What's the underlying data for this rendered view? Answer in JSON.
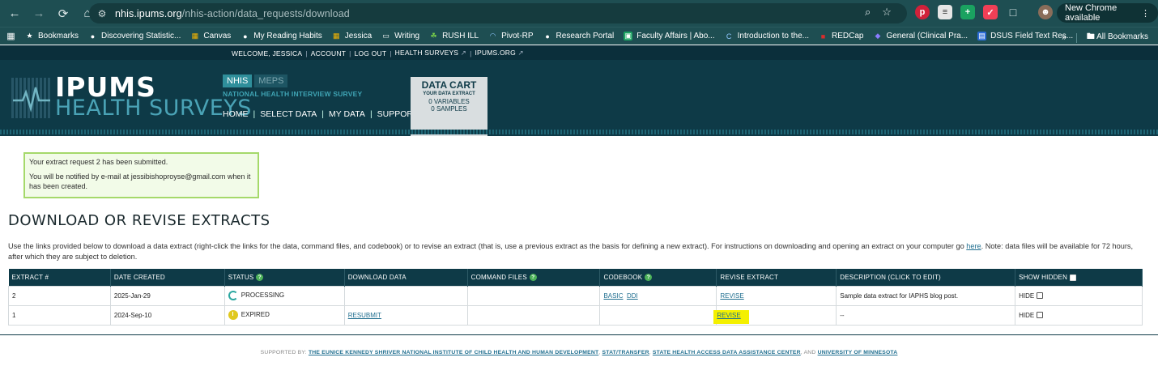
{
  "browser": {
    "url_host": "nhis.ipums.org",
    "url_path": "/nhis-action/data_requests/download",
    "new_chrome_label": "New Chrome available"
  },
  "bookmarks": {
    "items": [
      {
        "label": "Bookmarks",
        "icon": "star-icon"
      },
      {
        "label": "Discovering Statistic...",
        "icon": "globe-icon"
      },
      {
        "label": "Canvas",
        "icon": "grid-icon"
      },
      {
        "label": "My Reading Habits",
        "icon": "globe-icon"
      },
      {
        "label": "Jessica",
        "icon": "grid-icon"
      },
      {
        "label": "Writing",
        "icon": "folder-icon"
      },
      {
        "label": "RUSH ILL",
        "icon": "leaf-icon"
      },
      {
        "label": "Pivot-RP",
        "icon": "arc-icon"
      },
      {
        "label": "Research Portal",
        "icon": "globe-icon"
      },
      {
        "label": "Faculty Affairs | Abo...",
        "icon": "square-icon"
      },
      {
        "label": "Introduction to the...",
        "icon": "c-icon"
      },
      {
        "label": "REDCap",
        "icon": "redcap-icon"
      },
      {
        "label": "General (Clinical Pra...",
        "icon": "teams-icon"
      },
      {
        "label": "DSUS Field Text Res...",
        "icon": "doc-icon"
      }
    ],
    "all_bookmarks": "All Bookmarks"
  },
  "header": {
    "welcome": "WELCOME, JESSICA",
    "account": "ACCOUNT",
    "logout": "LOG OUT",
    "health_surveys": "HEALTH SURVEYS",
    "ipums_org": "IPUMS.ORG",
    "logo_top": "IPUMS",
    "logo_bottom": "HEALTH SURVEYS",
    "tab_nhis": "NHIS",
    "tab_meps": "MEPS",
    "survey_name": "NATIONAL HEALTH INTERVIEW SURVEY",
    "nav": [
      "HOME",
      "SELECT DATA",
      "MY DATA",
      "SUPPORT"
    ],
    "cart_title": "DATA CART",
    "cart_sub": "YOUR DATA EXTRACT",
    "cart_variables": "0  VARIABLES",
    "cart_samples": "0  SAMPLES"
  },
  "notice": {
    "line1": "Your extract request 2 has been submitted.",
    "line2": "You will be notified by e-mail at jessibishoproyse@gmail.com when it has been created."
  },
  "main": {
    "heading": "DOWNLOAD OR REVISE EXTRACTS",
    "intro_before": "Use the links provided below to download a data extract (right-click the links for the data, command files, and codebook) or to revise an extract (that is, use a previous extract as the basis for defining a new extract). For instructions on downloading and opening an extract on your computer go ",
    "intro_link": "here",
    "intro_after": ". Note: data files will be available for 72 hours, after which they are subject to deletion."
  },
  "table": {
    "headers": {
      "extract": "EXTRACT #",
      "date": "DATE CREATED",
      "status": "STATUS",
      "download": "DOWNLOAD DATA",
      "command": "COMMAND FILES",
      "codebook": "CODEBOOK",
      "revise": "REVISE EXTRACT",
      "description": "DESCRIPTION (CLICK TO EDIT)",
      "hidden": "SHOW HIDDEN"
    },
    "help_glyph": "?",
    "rows": [
      {
        "num": "2",
        "date": "2025-Jan-29",
        "status": "PROCESSING",
        "download": "",
        "codebook_basic": "BASIC",
        "codebook_ddi": "DDI",
        "revise": "REVISE",
        "description": "Sample data extract for IAPHS blog post.",
        "hide": "HIDE"
      },
      {
        "num": "1",
        "date": "2024-Sep-10",
        "status": "EXPIRED",
        "download": "RESUBMIT",
        "codebook_basic": "",
        "codebook_ddi": "",
        "revise": "REVISE",
        "description": "--",
        "hide": "HIDE"
      }
    ]
  },
  "footer": {
    "supported_by": "SUPPORTED BY:",
    "org1": "THE EUNICE KENNEDY SHRIVER NATIONAL INSTITUTE OF CHILD HEALTH AND HUMAN DEVELOPMENT",
    "org2": "STAT/TRANSFER",
    "org3": "STATE HEALTH ACCESS DATA ASSISTANCE CENTER",
    "and": "AND",
    "org4": "UNIVERSITY OF MINNESOTA"
  },
  "colors": {
    "header_bg": "#0e3a47",
    "browser_bg": "#1e4e52",
    "accent_teal": "#2f8f9b",
    "link": "#1f6e8f",
    "highlight": "#f4f000",
    "notice_border": "#a5d96a"
  }
}
